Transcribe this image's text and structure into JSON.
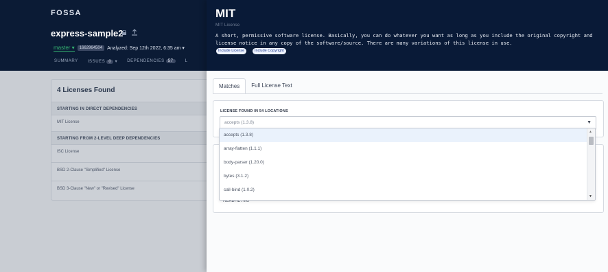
{
  "app": {
    "logo": "FOSSA",
    "project_title": "express-sample2",
    "branch": "master ▾",
    "revision": "1662964504",
    "analyzed": "Analyzed: Sep 12th 2022, 6:35 am ▾",
    "nav": [
      {
        "label": "SUMMARY"
      },
      {
        "label": "ISSUES",
        "count": "0"
      },
      {
        "label": "DEPENDENCIES",
        "count": "57"
      },
      {
        "label": "L"
      }
    ]
  },
  "licenses_card": {
    "title": "4 Licenses Found",
    "direct_header": "STARTING IN DIRECT DEPENDENCIES",
    "direct_items": [
      "MIT License"
    ],
    "deep_header": "STARTING FROM 2-LEVEL DEEP DEPENDENCIES",
    "deep_items": [
      "ISC License",
      "BSD 2-Clause \"Simplified\" License",
      "BSD 3-Clause \"New\" or \"Revised\" License"
    ]
  },
  "panel": {
    "title": "MIT",
    "subtitle": "MIT License",
    "description": "A short, permissive software license. Basically, you can do whatever you want as long as you include the original copyright and license notice in any copy of the software/source. There are many variations of this license in use.",
    "tags": [
      "Include License",
      "Include Copyright"
    ],
    "tabs": [
      "Matches",
      "Full License Text"
    ],
    "location_label": "LICENSE FOUND IN 54 LOCATIONS",
    "select_value": "accepts (1.3.8)",
    "dropdown_options": [
      "accepts (1.3.8)",
      "array-flatten (1.1.1)",
      "body-parser (1.20.0)",
      "bytes (3.1.2)",
      "call-bind (1.0.2)"
    ],
    "readme": "README.md"
  },
  "colors": {
    "header_bg": "#0b1b35",
    "accent_green": "#35b572",
    "panel_bg": "#fafbfc"
  },
  "icons": [
    "lock-icon",
    "upload-icon",
    "chevron-down-icon",
    "scroll-up-icon",
    "scroll-down-icon"
  ]
}
